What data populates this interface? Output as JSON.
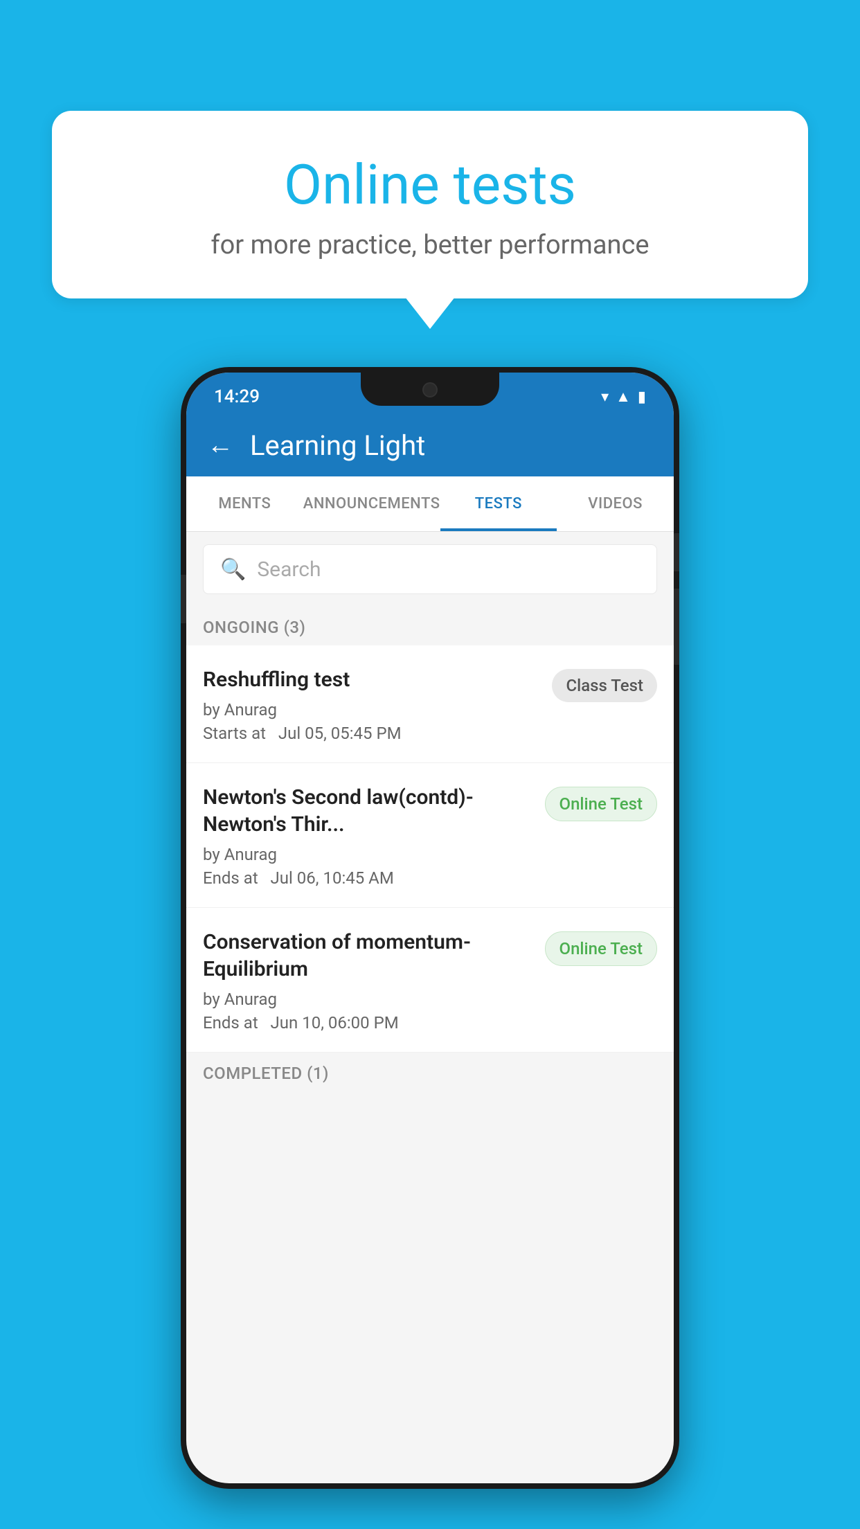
{
  "background_color": "#1ab4e8",
  "bubble": {
    "title": "Online tests",
    "subtitle": "for more practice, better performance"
  },
  "phone": {
    "status_bar": {
      "time": "14:29",
      "icons": [
        "wifi",
        "signal",
        "battery"
      ]
    },
    "header": {
      "title": "Learning Light",
      "back_label": "←"
    },
    "tabs": [
      {
        "label": "MENTS",
        "active": false
      },
      {
        "label": "ANNOUNCEMENTS",
        "active": false
      },
      {
        "label": "TESTS",
        "active": true
      },
      {
        "label": "VIDEOS",
        "active": false
      }
    ],
    "search": {
      "placeholder": "Search"
    },
    "ongoing_section": {
      "label": "ONGOING (3)",
      "items": [
        {
          "name": "Reshuffling test",
          "author": "by Anurag",
          "time_label": "Starts at",
          "time": "Jul 05, 05:45 PM",
          "badge": "Class Test",
          "badge_type": "class"
        },
        {
          "name": "Newton's Second law(contd)-Newton's Thir...",
          "author": "by Anurag",
          "time_label": "Ends at",
          "time": "Jul 06, 10:45 AM",
          "badge": "Online Test",
          "badge_type": "online"
        },
        {
          "name": "Conservation of momentum-Equilibrium",
          "author": "by Anurag",
          "time_label": "Ends at",
          "time": "Jun 10, 06:00 PM",
          "badge": "Online Test",
          "badge_type": "online"
        }
      ]
    },
    "completed_section": {
      "label": "COMPLETED (1)"
    }
  }
}
